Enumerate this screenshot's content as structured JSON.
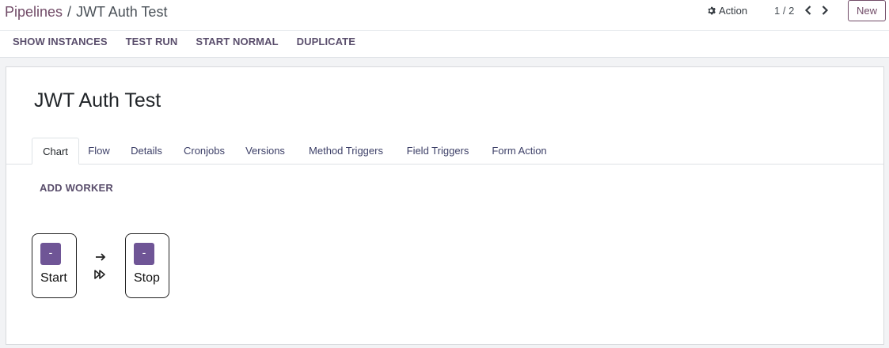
{
  "breadcrumb": {
    "parent": "Pipelines",
    "separator": "/",
    "current": "JWT Auth Test"
  },
  "toolbar": {
    "action_label": "Action",
    "pager": "1 / 2",
    "new_label": "New"
  },
  "header_buttons": [
    "SHOW INSTANCES",
    "TEST RUN",
    "START NORMAL",
    "DUPLICATE"
  ],
  "record": {
    "title": "JWT Auth Test"
  },
  "tabs": [
    "Chart",
    "Flow",
    "Details",
    "Cronjobs",
    "Versions",
    "Method Triggers",
    "Field Triggers",
    "Form Action"
  ],
  "active_tab": "Chart",
  "chart": {
    "add_worker_label": "ADD WORKER",
    "nodes": [
      {
        "label": "Start",
        "button": "-"
      },
      {
        "label": "Stop",
        "button": "-"
      }
    ]
  },
  "colors": {
    "brand": "#714b67",
    "node_button": "#6f5596"
  },
  "icons": [
    "gear-icon",
    "chevron-left-icon",
    "chevron-right-icon",
    "arrow-right-icon",
    "fast-forward-icon"
  ]
}
